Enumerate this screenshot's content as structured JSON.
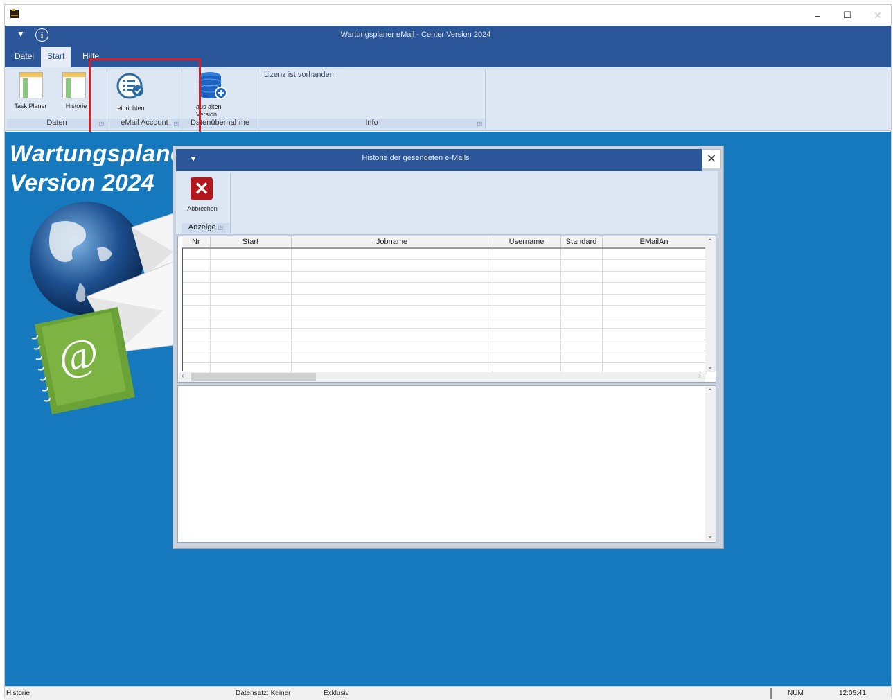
{
  "window": {
    "title": "Wartungsplaner eMail - Center Version 2024",
    "controls": {
      "minimize": "–",
      "maximize": "☐",
      "close": "✕"
    }
  },
  "quick_access": {
    "menu_icon": "dropdown-arrow-icon",
    "info_icon": "info-icon",
    "info_glyph": "i"
  },
  "tabs": [
    {
      "label": "Datei",
      "active": false
    },
    {
      "label": "Start",
      "active": true
    },
    {
      "label": "Hilfe",
      "active": false
    }
  ],
  "ribbon": {
    "groups": [
      {
        "label": "Daten",
        "buttons": [
          "Task Planer",
          "Historie"
        ]
      },
      {
        "label": "eMail Account",
        "buttons": [
          "einrichten"
        ]
      },
      {
        "label": "Datenübernahme",
        "buttons": [
          "aus alten Version"
        ]
      },
      {
        "label": "Info",
        "text": "Lizenz ist vorhanden"
      }
    ]
  },
  "brand": {
    "line1": "Wartungsplaner",
    "line2": "Version 2024"
  },
  "dialog": {
    "title": "Historie der gesendeten e-Mails",
    "close_glyph": "✕",
    "cancel_button": "Abbrechen",
    "group_label": "Anzeige",
    "columns": [
      "Nr",
      "Start",
      "Jobname",
      "Username",
      "Standard",
      "EMailAn"
    ]
  },
  "statusbar": {
    "left": "Historie",
    "record": "Datensatz: Keiner",
    "mode": "Exklusiv",
    "num": "NUM",
    "time": "12:05:41"
  },
  "colors": {
    "accent": "#2b579a",
    "desktop": "#1679be",
    "highlight": "#d81f26",
    "cancel": "#b5161c"
  }
}
